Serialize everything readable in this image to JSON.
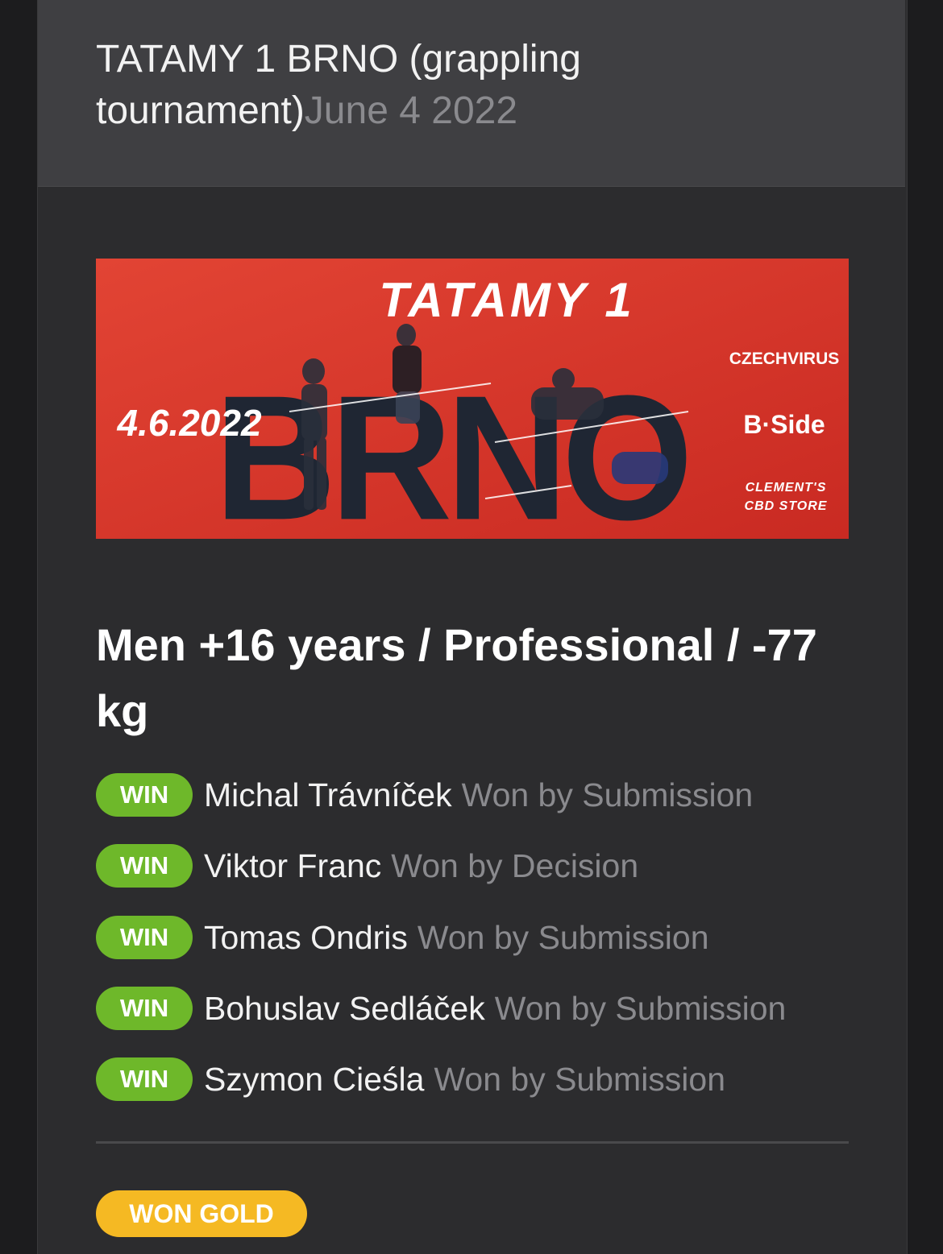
{
  "event": {
    "title": "TATAMY 1 BRNO (grappling tournament)",
    "date": "June 4 2022"
  },
  "banner": {
    "logo_text": "TATAMY 1",
    "city": "BRNO",
    "date": "4.6.2022",
    "sponsors": [
      "CZECHVIRUS",
      "B·Side",
      "CLEMENT'S",
      "CBD STORE"
    ],
    "colors": {
      "background": "#d9362b",
      "text": "#ffffff",
      "city": "#1f2633"
    }
  },
  "division": {
    "title": "Men +16 years / Professional / -77 kg"
  },
  "matches": [
    {
      "result": "WIN",
      "opponent": "Michal Trávníček",
      "method": "Won by Submission"
    },
    {
      "result": "WIN",
      "opponent": "Viktor Franc",
      "method": "Won by Decision"
    },
    {
      "result": "WIN",
      "opponent": "Tomas Ondris",
      "method": "Won by Submission"
    },
    {
      "result": "WIN",
      "opponent": "Bohuslav Sedláček",
      "method": "Won by Submission"
    },
    {
      "result": "WIN",
      "opponent": "Szymon Cieśla",
      "method": "Won by Submission"
    }
  ],
  "medal": {
    "label": "WON GOLD",
    "color": "#f5b923"
  },
  "colors": {
    "win_badge": "#6eb82a",
    "muted_text": "#8a8a8e"
  }
}
